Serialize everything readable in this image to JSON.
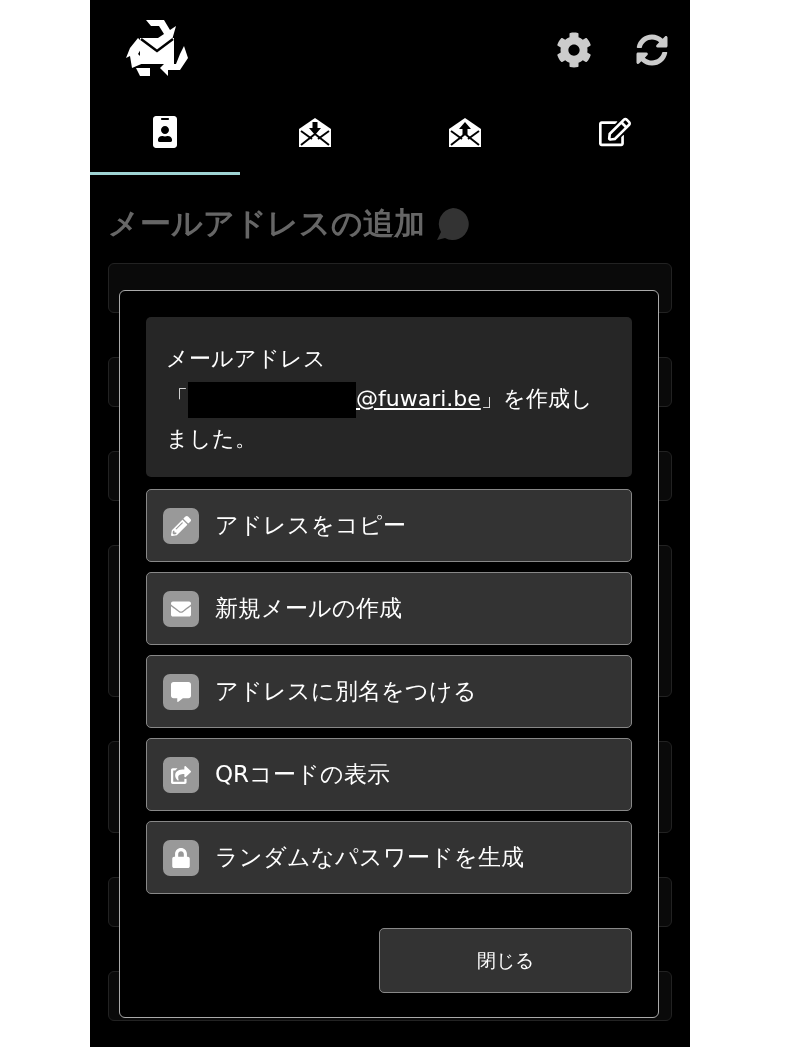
{
  "tabs": [
    {
      "kind": "contact",
      "selected": true
    },
    {
      "kind": "inbox",
      "selected": false
    },
    {
      "kind": "outbox",
      "selected": false
    },
    {
      "kind": "compose",
      "selected": false
    }
  ],
  "page_title": "メールアドレスの追加",
  "dialog": {
    "message": {
      "intro": "メールアドレス",
      "open_bracket": "「",
      "redacted": true,
      "link": "@fuwari.be",
      "close_bracket": "」を作成しました。"
    },
    "actions": [
      {
        "kind": "copy",
        "label": "アドレスをコピー"
      },
      {
        "kind": "mail",
        "label": "新規メールの作成"
      },
      {
        "kind": "alias",
        "label": "アドレスに別名をつける"
      },
      {
        "kind": "qr",
        "label": "QRコードの表示"
      },
      {
        "kind": "password",
        "label": "ランダムなパスワードを生成"
      }
    ],
    "close_button": "閉じる"
  }
}
